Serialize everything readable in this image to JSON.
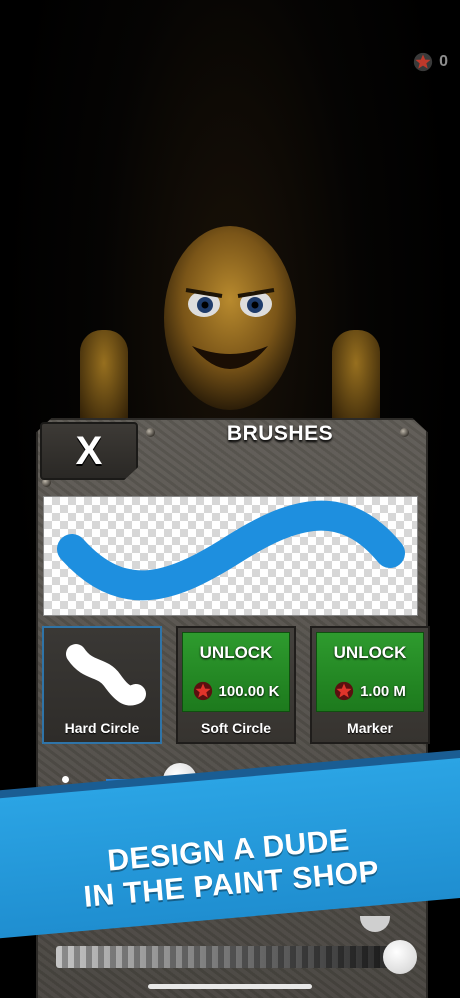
{
  "currency": {
    "amount": "0",
    "icon": "star-icon",
    "color": "#c0392b"
  },
  "panel": {
    "title": "BRUSHES",
    "close_label": "X"
  },
  "preview": {
    "stroke_color": "#1e8fdf"
  },
  "brushes": [
    {
      "name": "Hard Circle",
      "state": "selected"
    },
    {
      "name": "Soft Circle",
      "state": "locked",
      "unlock_label": "UNLOCK",
      "price": "100.00 K"
    },
    {
      "name": "Marker",
      "state": "locked",
      "unlock_label": "UNLOCK",
      "price": "1.00 M"
    }
  ],
  "size_slider": {
    "value": 0.3
  },
  "opacity_slider": {
    "value": 1.0
  },
  "banner": {
    "line1": "DESIGN A DUDE",
    "line2": "IN THE PAINT SHOP"
  }
}
